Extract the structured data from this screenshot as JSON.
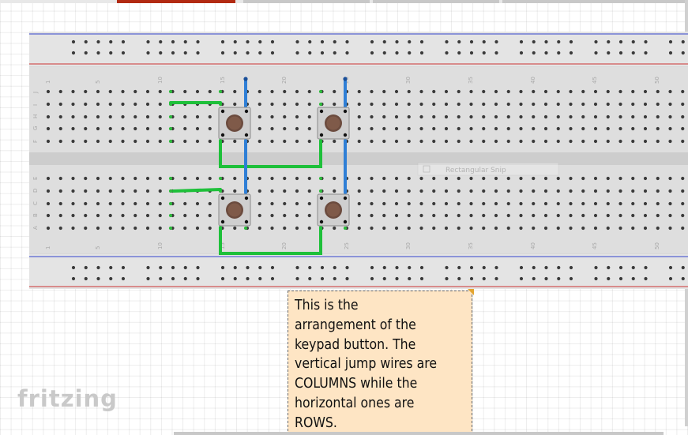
{
  "app": {
    "logo_text": "fritzing"
  },
  "breadboard": {
    "column_numbers": [
      "1",
      "5",
      "10",
      "15",
      "20",
      "25",
      "30",
      "35",
      "40",
      "45",
      "50"
    ],
    "top_row_letters": [
      "J",
      "I",
      "H",
      "G",
      "F"
    ],
    "bottom_row_letters": [
      "E",
      "D",
      "C",
      "B",
      "A"
    ],
    "pushbutton_count": 4,
    "jumper_colors": {
      "column": "#2f7fd6",
      "row": "#1ec03a"
    },
    "rail_colors": {
      "positive": "#cc3333",
      "negative": "#3344cc"
    }
  },
  "ghost_overlay": {
    "label": "Rectangular Snip"
  },
  "note": {
    "text": "This is the\narrangement of the\nkeypad button. The\nvertical jump wires are\nCOLUMNS while the\nhorizontal ones are\nROWS."
  }
}
